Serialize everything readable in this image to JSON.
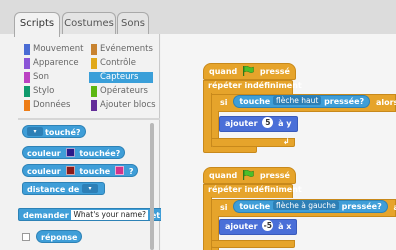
{
  "tabs": [
    {
      "label": "Scripts",
      "active": true
    },
    {
      "label": "Costumes",
      "active": false
    },
    {
      "label": "Sons",
      "active": false
    }
  ],
  "categories": [
    {
      "label": "Mouvement",
      "color": "#4a6cd4"
    },
    {
      "label": "Evénements",
      "color": "#c88330"
    },
    {
      "label": "Apparence",
      "color": "#8a55d7"
    },
    {
      "label": "Contrôle",
      "color": "#e1a91a"
    },
    {
      "label": "Son",
      "color": "#bb42c3"
    },
    {
      "label": "Capteurs",
      "color": "#2ca5e2",
      "active": true
    },
    {
      "label": "Stylo",
      "color": "#0e9a6c"
    },
    {
      "label": "Opérateurs",
      "color": "#5cb712"
    },
    {
      "label": "Données",
      "color": "#ee7d16"
    },
    {
      "label": "Ajouter blocs",
      "color": "#632d99"
    }
  ],
  "palette": {
    "touching": "touché?",
    "touching_color": "couleur",
    "touching_color_end": "touchée?",
    "color_touching_a": "couleur",
    "color_touching_b": "touche",
    "color_touching_c": "?",
    "distance": "distance de",
    "ask": "demander",
    "ask_value": "What's your name?",
    "ask_end": "et",
    "answer": "réponse",
    "colors": {
      "swatch1": "#2a1a8a",
      "swatch2": "#2a1a8a",
      "swatch3": "#d0348a"
    }
  },
  "scripts": [
    {
      "hat_start": "quand",
      "hat_end": "pressé",
      "forever": "répéter indéfiniment",
      "if_label": "si",
      "cond_start": "touche",
      "cond_key": "flèche haut",
      "cond_end": "pressée?",
      "then_label": "alors",
      "action_start": "ajouter",
      "action_value": "5",
      "action_end": "à y"
    },
    {
      "hat_start": "quand",
      "hat_end": "pressé",
      "forever": "répéter indéfiniment",
      "if_label": "si",
      "cond_start": "touche",
      "cond_key": "flèche à gauche",
      "cond_end": "pressée?",
      "then_label": "alo",
      "action_start": "ajouter",
      "action_value": "-5",
      "action_end": "à x"
    }
  ]
}
